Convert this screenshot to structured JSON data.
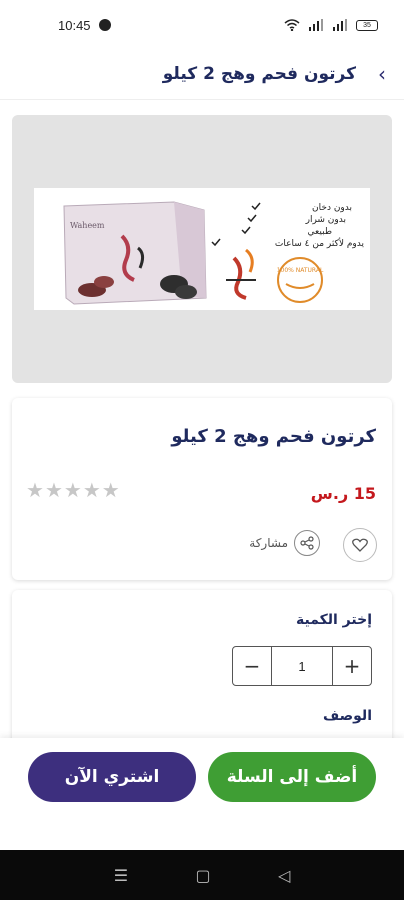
{
  "status": {
    "time": "10:45",
    "battery": "35"
  },
  "header": {
    "title": "كرتون فحم وهج 2 كيلو",
    "back_icon": "chevron-left-icon"
  },
  "product": {
    "image_texts": {
      "features": [
        "بدون دخان",
        "بدون شرار",
        "طبيعي",
        "يدوم لأكثر من ٤ ساعات"
      ],
      "brand": "فحم وهج",
      "badge": "100% NATURAL",
      "box_label": "Waheem"
    },
    "name": "كرتون فحم وهج 2 كيلو",
    "price": "15 ر.س",
    "rating": 0,
    "rating_max": 5,
    "share_label": "مشاركة"
  },
  "quantity": {
    "label": "إختر الكمية",
    "value": "1",
    "minus": "−",
    "plus": "+"
  },
  "description": {
    "label": "الوصف"
  },
  "actions": {
    "add_to_cart": "أضف إلى السلة",
    "buy_now": "اشتري الآن"
  },
  "colors": {
    "primary": "#3d2f7e",
    "cart": "#3f9e34",
    "price": "#c4181d",
    "title": "#1f2a5e"
  }
}
